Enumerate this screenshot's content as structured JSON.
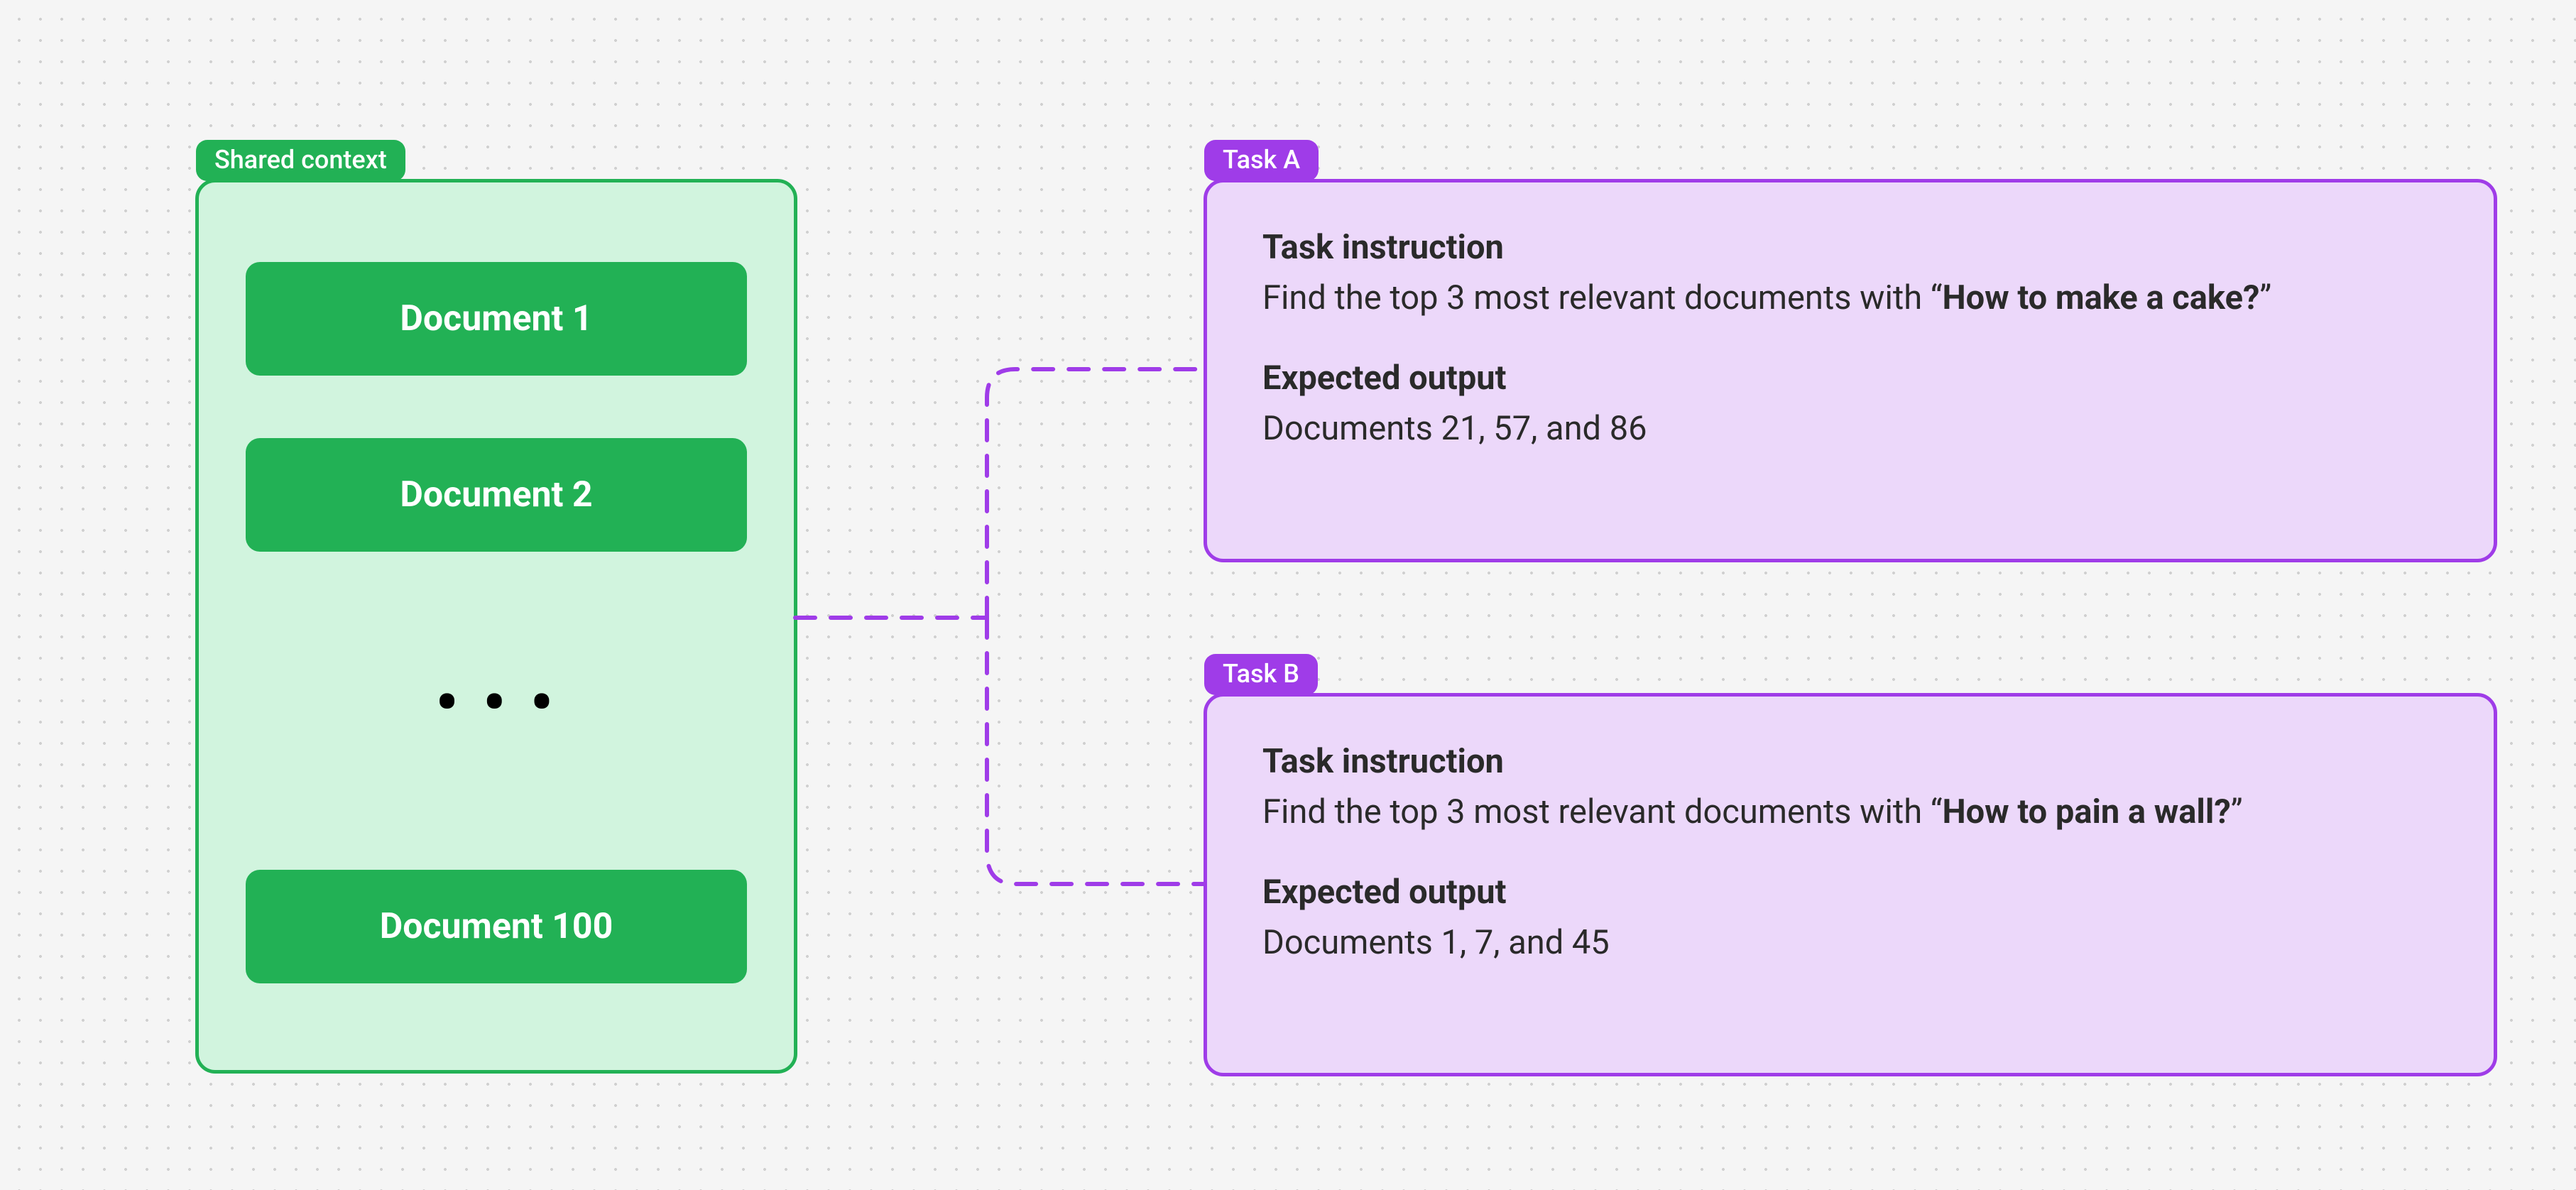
{
  "shared": {
    "tag": "Shared context",
    "doc1": "Document 1",
    "doc2": "Document 2",
    "doc3": "Document 100",
    "dots": "• • •"
  },
  "taskA": {
    "tag": "Task A",
    "instruction_label": "Task instruction",
    "instruction_prefix": "Find the top 3 most relevant documents with “",
    "instruction_bold": "How to make a cake?",
    "instruction_suffix": "”",
    "output_label": "Expected output",
    "output_text": "Documents 21, 57, and 86"
  },
  "taskB": {
    "tag": "Task B",
    "instruction_label": "Task instruction",
    "instruction_prefix": "Find the top 3 most relevant documents with “",
    "instruction_bold": "How to pain a wall?",
    "instruction_suffix": "”",
    "output_label": "Expected output",
    "output_text": "Documents 1, 7, and 45"
  },
  "colors": {
    "green": "#22b155",
    "green_fill": "#d1f4de",
    "purple": "#9f3ce8",
    "purple_fill": "#ecd8fa"
  }
}
